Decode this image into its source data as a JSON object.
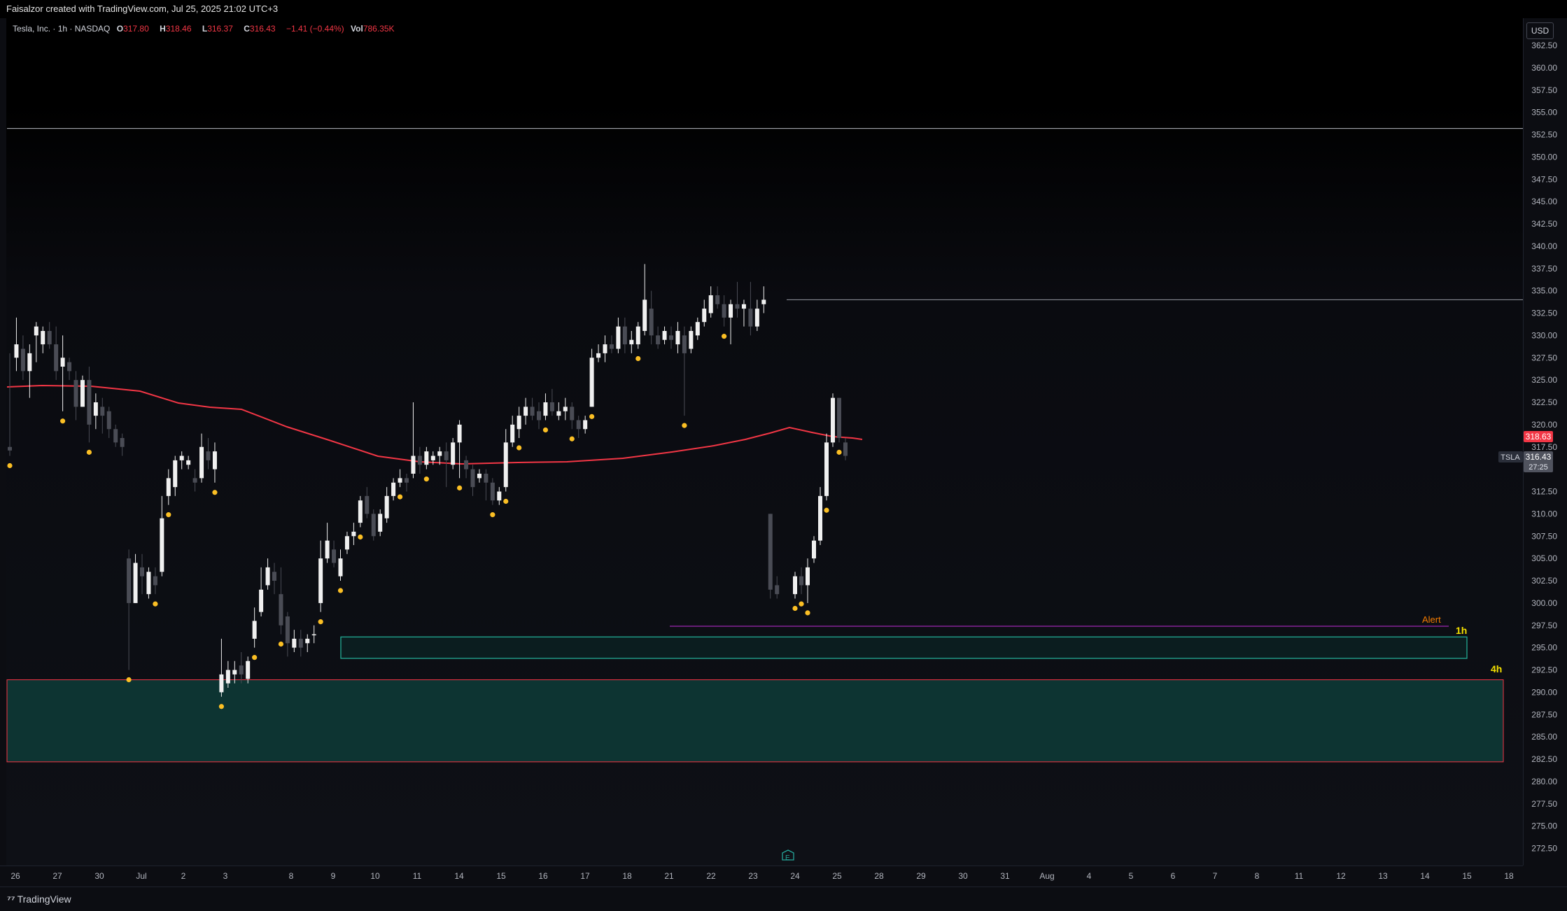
{
  "header": {
    "credit": "Faisalzor created with TradingView.com, Jul 25, 2025 21:02 UTC+3"
  },
  "legend": {
    "symbol": "Tesla, Inc. · 1h · NASDAQ",
    "open_label": "O",
    "open": "317.80",
    "high_label": "H",
    "high": "318.46",
    "low_label": "L",
    "low": "316.37",
    "close_label": "C",
    "close": "316.43",
    "change": "−1.41 (−0.44%)",
    "vol_label": "Vol",
    "vol": "786.35K"
  },
  "currency_button": "USD",
  "price_axis_labels": [
    "362.50",
    "360.00",
    "357.50",
    "355.00",
    "352.50",
    "350.00",
    "347.50",
    "345.00",
    "342.50",
    "340.00",
    "337.50",
    "335.00",
    "332.50",
    "330.00",
    "327.50",
    "325.00",
    "322.50",
    "320.00",
    "317.50",
    "312.50",
    "310.00",
    "307.50",
    "305.00",
    "302.50",
    "300.00",
    "297.50",
    "295.00",
    "292.50",
    "290.00",
    "287.50",
    "285.00",
    "282.50",
    "280.00",
    "277.50",
    "275.00",
    "272.50"
  ],
  "time_axis_labels": [
    "26",
    "27",
    "30",
    "Jul",
    "2",
    "3",
    "8",
    "9",
    "10",
    "11",
    "14",
    "15",
    "16",
    "17",
    "18",
    "21",
    "22",
    "23",
    "24",
    "25",
    "28",
    "29",
    "30",
    "31",
    "Aug",
    "4",
    "5",
    "6",
    "7",
    "8",
    "11",
    "12",
    "13",
    "14",
    "15",
    "18"
  ],
  "price_badges": {
    "ma_value": "318.63",
    "symbol_tag": "TSLA",
    "last_price": "316.43",
    "countdown": "27:25"
  },
  "annotations": {
    "alert_label": "Alert",
    "zone_1h_label": "1h",
    "zone_4h_label": "4h",
    "earnings_marker": "E"
  },
  "footer": {
    "brand": "TradingView"
  },
  "colors": {
    "bull_candle": "#f0f0f0",
    "bear_candle": "#4a4c55",
    "ma_line": "#f23645",
    "signal_dot": "#fbbf24",
    "zone_fill": "#0d3432",
    "zone_1h_border": "#22ab94",
    "zone_4h_border": "#f23645",
    "alert_line": "#9c27b0",
    "alert_text": "#f57c00",
    "label_yellow": "#f5e000"
  },
  "chart_data": {
    "type": "candlestick",
    "title": "Tesla, Inc. · 1h · NASDAQ",
    "ylim": [
      271,
      364
    ],
    "overlays": {
      "moving_average_last": 318.63,
      "horizontal_lines": [
        353.2,
        334.0
      ],
      "alert_level": 297.4,
      "demand_zone_1h": [
        293.8,
        296.2
      ],
      "demand_zone_4h": [
        282.2,
        291.4
      ]
    },
    "candles": [
      [
        317.5,
        317.1,
        328.0,
        316.5
      ],
      [
        327.5,
        329.0,
        332.0,
        326.0
      ],
      [
        328.5,
        326.0,
        330.0,
        325.0
      ],
      [
        326.0,
        328.0,
        329.0,
        323.0
      ],
      [
        330.0,
        331.0,
        331.5,
        327.0
      ],
      [
        329.0,
        330.5,
        331.0,
        328.0
      ],
      [
        330.5,
        329.0,
        331.5,
        328.5
      ],
      [
        329.0,
        326.0,
        331.0,
        325.0
      ],
      [
        326.5,
        327.5,
        330.0,
        321.5
      ],
      [
        327.0,
        326.0,
        327.5,
        325.0
      ],
      [
        325.0,
        322.0,
        326.0,
        320.5
      ],
      [
        322.0,
        325.0,
        325.5,
        322.0
      ],
      [
        325.0,
        320.0,
        326.5,
        318.0
      ],
      [
        321.0,
        322.5,
        323.5,
        319.5
      ],
      [
        322.0,
        321.0,
        323.0,
        319.0
      ],
      [
        321.5,
        319.5,
        322.0,
        318.5
      ],
      [
        319.5,
        318.0,
        320.0,
        317.5
      ],
      [
        318.5,
        317.5,
        319.0,
        316.5
      ],
      [
        305.0,
        300.0,
        306.0,
        292.5
      ],
      [
        300.0,
        304.5,
        305.5,
        300.0
      ],
      [
        304.0,
        303.0,
        305.5,
        301.0
      ],
      [
        301.0,
        303.5,
        304.0,
        300.5
      ],
      [
        303.0,
        302.0,
        304.0,
        301.0
      ],
      [
        303.5,
        309.5,
        312.0,
        303.0
      ],
      [
        312.0,
        314.0,
        315.0,
        311.0
      ],
      [
        313.0,
        316.0,
        316.5,
        312.0
      ],
      [
        316.0,
        316.5,
        317.0,
        315.0
      ],
      [
        315.5,
        316.0,
        316.5,
        315.0
      ],
      [
        314.0,
        313.5,
        315.0,
        312.5
      ],
      [
        314.0,
        317.5,
        319.0,
        313.5
      ],
      [
        317.0,
        316.0,
        318.5,
        315.0
      ],
      [
        315.0,
        317.0,
        318.0,
        313.5
      ],
      [
        290.0,
        292.0,
        296.0,
        289.5
      ],
      [
        291.0,
        292.5,
        293.5,
        290.5
      ],
      [
        292.0,
        292.5,
        293.5,
        291.0
      ],
      [
        293.0,
        292.0,
        294.5,
        291.0
      ],
      [
        291.5,
        293.5,
        294.0,
        291.0
      ],
      [
        296.0,
        298.0,
        299.5,
        295.0
      ],
      [
        299.0,
        301.5,
        304.0,
        298.5
      ],
      [
        302.0,
        304.0,
        305.0,
        301.5
      ],
      [
        303.5,
        302.5,
        304.5,
        301.0
      ],
      [
        301.0,
        297.5,
        304.0,
        296.5
      ],
      [
        298.5,
        295.5,
        299.0,
        294.0
      ],
      [
        295.0,
        296.0,
        297.0,
        294.5
      ],
      [
        296.0,
        295.0,
        297.0,
        294.0
      ],
      [
        295.5,
        296.0,
        296.5,
        294.5
      ],
      [
        296.5,
        296.5,
        297.5,
        295.5
      ],
      [
        300.0,
        305.0,
        307.0,
        299.0
      ],
      [
        305.0,
        307.0,
        309.0,
        304.5
      ],
      [
        306.0,
        304.5,
        307.0,
        304.0
      ],
      [
        303.0,
        305.0,
        306.0,
        302.5
      ],
      [
        306.0,
        307.5,
        308.0,
        305.5
      ],
      [
        307.5,
        308.0,
        309.0,
        306.5
      ],
      [
        309.0,
        311.5,
        312.0,
        308.5
      ],
      [
        312.0,
        310.0,
        313.0,
        309.5
      ],
      [
        310.0,
        307.5,
        310.5,
        307.0
      ],
      [
        308.0,
        310.0,
        310.5,
        307.5
      ],
      [
        309.5,
        312.0,
        313.0,
        309.0
      ],
      [
        312.0,
        313.5,
        314.0,
        311.5
      ],
      [
        313.5,
        314.0,
        315.0,
        313.0
      ],
      [
        314.0,
        313.5,
        314.5,
        312.5
      ],
      [
        314.5,
        316.5,
        322.5,
        314.0
      ],
      [
        316.5,
        315.5,
        317.5,
        314.5
      ],
      [
        315.5,
        317.0,
        317.5,
        315.0
      ],
      [
        316.0,
        316.5,
        317.0,
        315.5
      ],
      [
        316.5,
        317.0,
        317.5,
        315.5
      ],
      [
        317.0,
        316.0,
        318.0,
        313.0
      ],
      [
        315.5,
        318.0,
        318.5,
        315.0
      ],
      [
        318.0,
        320.0,
        320.5,
        314.0
      ],
      [
        316.0,
        315.0,
        316.5,
        314.0
      ],
      [
        315.0,
        313.0,
        315.5,
        312.0
      ],
      [
        314.0,
        314.5,
        315.0,
        313.5
      ],
      [
        314.5,
        313.5,
        315.0,
        311.5
      ],
      [
        313.5,
        311.5,
        314.0,
        311.0
      ],
      [
        311.5,
        312.5,
        313.0,
        311.0
      ],
      [
        313.0,
        318.0,
        319.5,
        312.5
      ],
      [
        318.0,
        320.0,
        321.0,
        317.5
      ],
      [
        319.5,
        321.0,
        322.0,
        318.5
      ],
      [
        321.0,
        322.0,
        323.0,
        320.0
      ],
      [
        322.0,
        321.0,
        323.0,
        320.5
      ],
      [
        321.5,
        320.5,
        322.5,
        319.5
      ],
      [
        321.0,
        322.5,
        323.5,
        320.5
      ],
      [
        322.5,
        321.5,
        324.0,
        321.0
      ],
      [
        321.0,
        321.5,
        322.5,
        320.5
      ],
      [
        321.5,
        322.0,
        323.0,
        320.5
      ],
      [
        322.0,
        320.5,
        322.5,
        319.5
      ],
      [
        320.5,
        319.5,
        321.0,
        318.5
      ],
      [
        319.5,
        320.5,
        321.0,
        319.0
      ],
      [
        322.0,
        327.5,
        328.5,
        322.0
      ],
      [
        327.5,
        328.0,
        329.0,
        327.0
      ],
      [
        328.0,
        329.0,
        330.0,
        327.0
      ],
      [
        329.0,
        328.5,
        330.0,
        328.0
      ],
      [
        328.5,
        331.0,
        332.0,
        328.0
      ],
      [
        331.0,
        329.0,
        332.0,
        328.0
      ],
      [
        329.0,
        329.5,
        330.5,
        328.0
      ],
      [
        329.0,
        331.0,
        331.5,
        328.5
      ],
      [
        330.5,
        334.0,
        338.0,
        330.0
      ],
      [
        333.0,
        330.0,
        335.0,
        329.0
      ],
      [
        330.0,
        329.0,
        331.0,
        328.5
      ],
      [
        329.5,
        330.5,
        331.0,
        329.0
      ],
      [
        330.0,
        329.5,
        331.0,
        328.5
      ],
      [
        329.0,
        330.5,
        331.5,
        328.0
      ],
      [
        330.0,
        328.0,
        331.0,
        321.0
      ],
      [
        328.5,
        330.5,
        331.0,
        328.0
      ],
      [
        330.0,
        331.5,
        332.0,
        329.5
      ],
      [
        331.5,
        333.0,
        334.0,
        331.0
      ],
      [
        332.5,
        334.5,
        335.5,
        332.0
      ],
      [
        334.5,
        333.5,
        335.5,
        333.0
      ],
      [
        333.5,
        332.0,
        334.5,
        331.0
      ],
      [
        332.0,
        333.5,
        334.0,
        329.0
      ],
      [
        333.5,
        333.0,
        336.0,
        332.0
      ],
      [
        333.0,
        333.5,
        334.0,
        331.0
      ],
      [
        333.0,
        331.0,
        336.0,
        330.0
      ],
      [
        331.0,
        333.0,
        334.0,
        330.5
      ],
      [
        333.5,
        334.0,
        335.5,
        332.5
      ],
      [
        310.0,
        301.5,
        310.0,
        300.5
      ],
      [
        302.0,
        301.0,
        303.0,
        300.5
      ],
      [
        301.0,
        303.0,
        303.5,
        300.5
      ],
      [
        303.0,
        302.0,
        304.0,
        301.0
      ],
      [
        302.0,
        304.0,
        305.0,
        300.0
      ],
      [
        305.0,
        307.0,
        307.5,
        304.5
      ],
      [
        307.0,
        312.0,
        313.0,
        306.5
      ],
      [
        312.0,
        318.0,
        319.0,
        311.5
      ],
      [
        318.0,
        323.0,
        323.5,
        317.5
      ],
      [
        323.0,
        318.5,
        323.0,
        318.0
      ],
      [
        318.0,
        316.5,
        318.5,
        316.0
      ]
    ]
  }
}
